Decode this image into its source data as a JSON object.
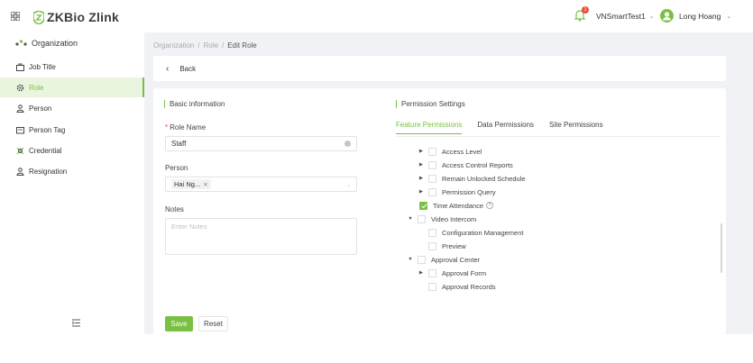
{
  "app": {
    "brand": "ZKBio Zlink"
  },
  "header": {
    "notification_count": "1",
    "tenant": "VNSmartTest1",
    "user_name": "Long Hoang"
  },
  "sidebar": {
    "top_item": "Organization",
    "items": [
      {
        "label": "Job Title",
        "icon": "briefcase-icon"
      },
      {
        "label": "Role",
        "icon": "gear-icon",
        "active": true
      },
      {
        "label": "Person",
        "icon": "person-icon"
      },
      {
        "label": "Person Tag",
        "icon": "tag-icon"
      },
      {
        "label": "Credential",
        "icon": "credential-icon"
      },
      {
        "label": "Resignation",
        "icon": "person-icon"
      }
    ]
  },
  "breadcrumb": {
    "items": [
      "Organization",
      "Role"
    ],
    "current": "Edit Role"
  },
  "back": {
    "label": "Back"
  },
  "basic": {
    "title": "Basic information",
    "role_name_label": "Role Name",
    "role_name_value": "Staff",
    "person_label": "Person",
    "person_tag": "Hai Ng...",
    "notes_label": "Notes",
    "notes_placeholder": "Enter Notes"
  },
  "permissions": {
    "title": "Permission Settings",
    "tabs": [
      "Feature Permissions",
      "Data Permissions",
      "Site Permissions"
    ],
    "tree": [
      {
        "label": "Access Level"
      },
      {
        "label": "Access Control Reports"
      },
      {
        "label": "Remain Unlocked Schedule"
      },
      {
        "label": "Permission Query"
      },
      {
        "label": "Time Attendance"
      },
      {
        "label": "Video Intercom"
      },
      {
        "label": "Configuration Management"
      },
      {
        "label": "Preview"
      },
      {
        "label": "Approval Center"
      },
      {
        "label": "Approval Form"
      },
      {
        "label": "Approval Records"
      }
    ]
  },
  "footer": {
    "save_label": "Save",
    "reset_label": "Reset"
  },
  "colors": {
    "accent": "#7ac143",
    "badge": "#f04a3a"
  }
}
